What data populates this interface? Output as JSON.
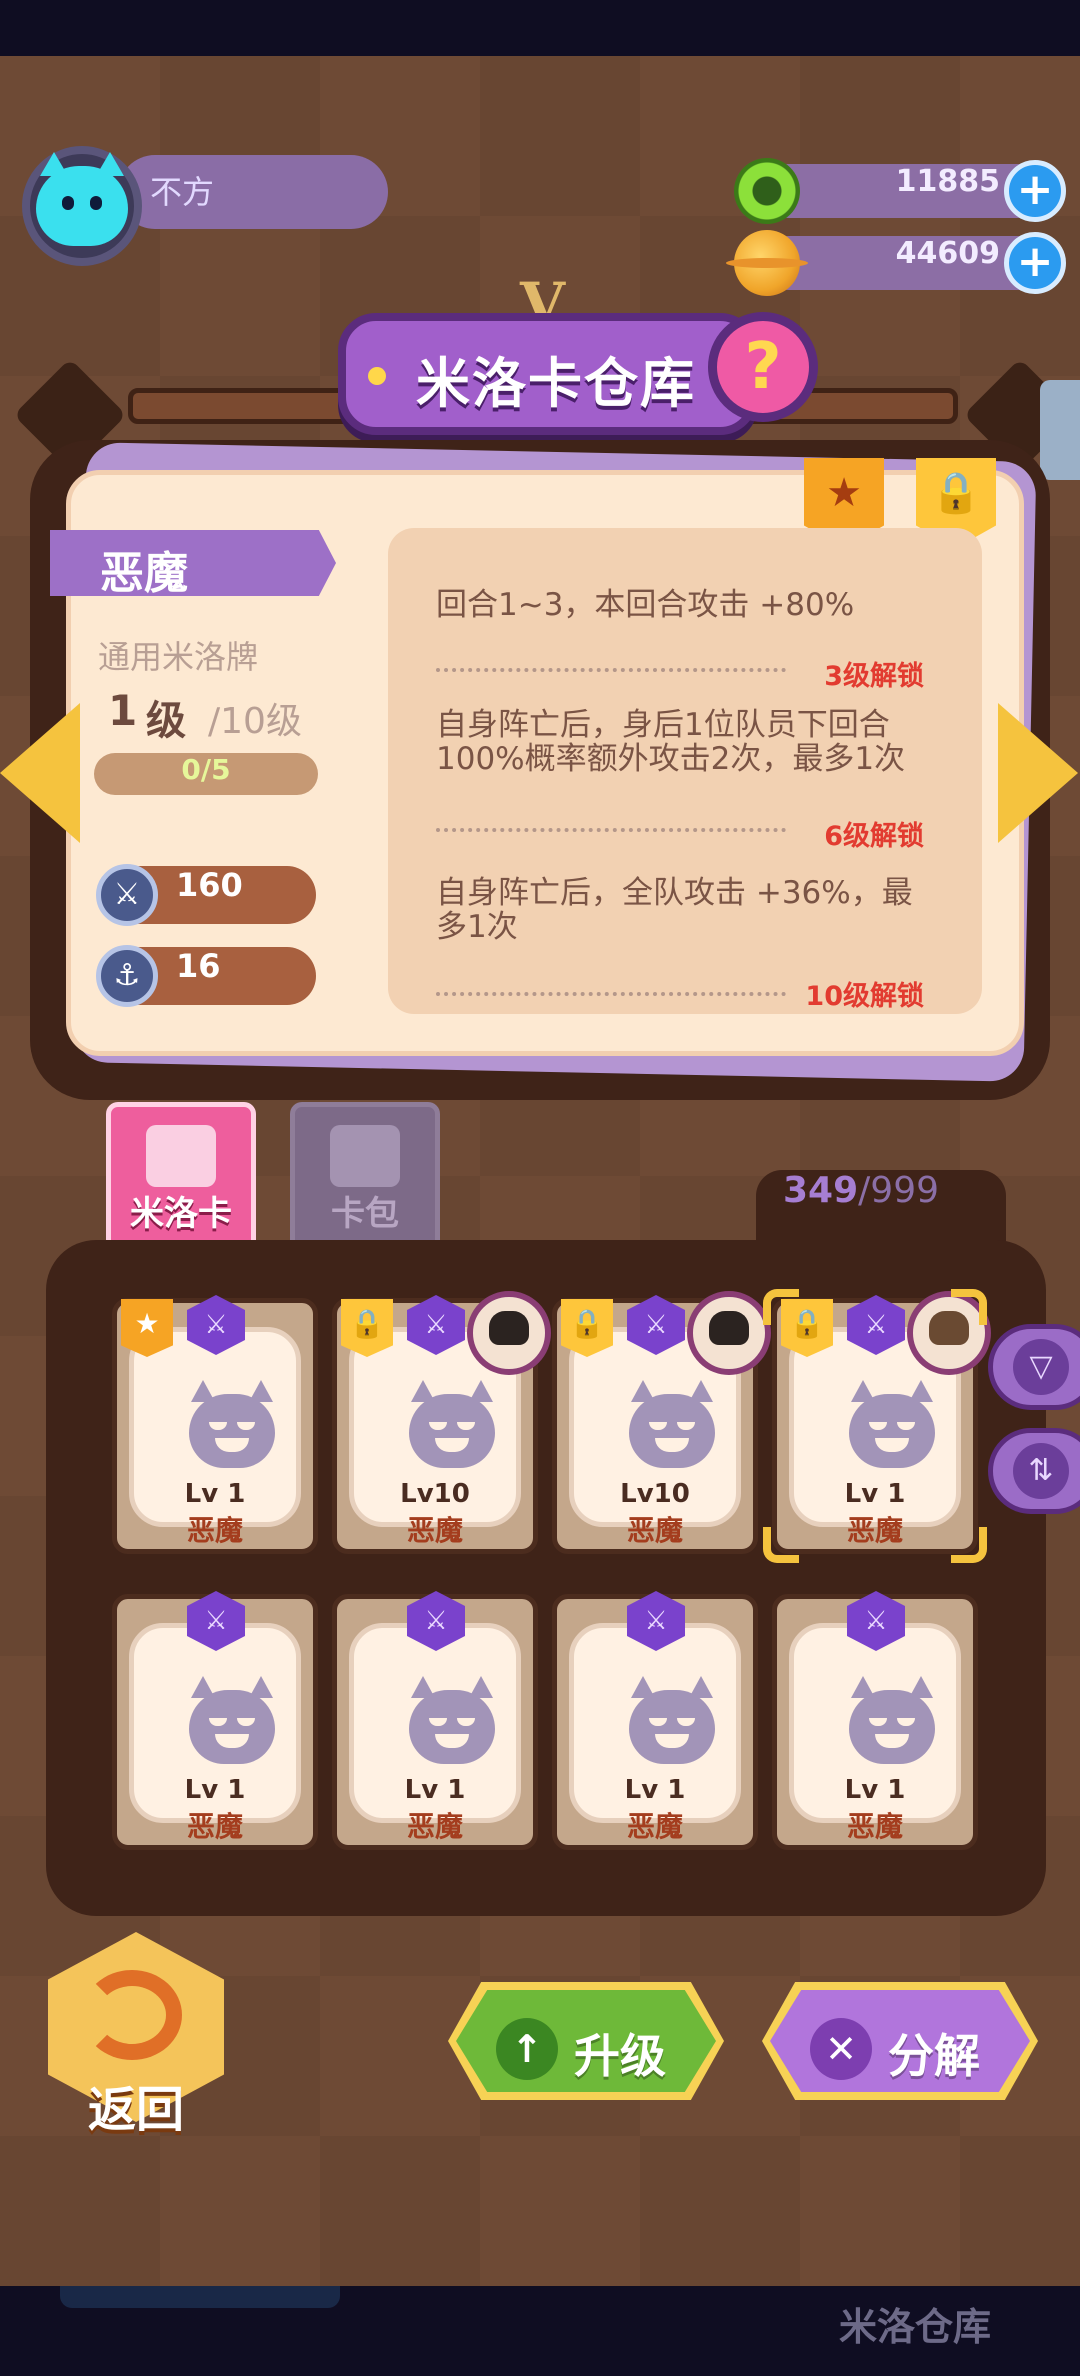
{
  "player": {
    "name": "不方"
  },
  "currencies": [
    {
      "value": "11885",
      "icon": "green-donut-coin-icon"
    },
    {
      "value": "44609",
      "icon": "gold-planet-coin-icon"
    }
  ],
  "title": {
    "text": "米洛卡仓库",
    "help": "?"
  },
  "card_detail": {
    "name": "恶魔",
    "type": "通用米洛牌",
    "level": "1",
    "level_unit": "级",
    "level_max": "/10级",
    "progress_text": "0/5",
    "progress": 0,
    "stats": [
      {
        "icon": "attack-icon",
        "value": "160"
      },
      {
        "icon": "defense-icon",
        "value": "16"
      }
    ],
    "skills": [
      {
        "desc": "回合1~3，本回合攻击 +80%",
        "unlock": "3级解锁"
      },
      {
        "desc": "自身阵亡后，身后1位队员下回合100%概率额外攻击2次，最多1次",
        "unlock": "6级解锁"
      },
      {
        "desc": "自身阵亡后，全队攻击 +36%，最多1次",
        "unlock": "10级解锁"
      }
    ]
  },
  "tabs": [
    {
      "label": "米洛卡",
      "active": true
    },
    {
      "label": "卡包",
      "active": false
    }
  ],
  "inventory": {
    "count": "349",
    "max": "/999",
    "cards": [
      {
        "lv": "Lv 1",
        "name": "恶魔",
        "badge": "star",
        "avatar": false
      },
      {
        "lv": "Lv10",
        "name": "恶魔",
        "badge": "lock",
        "avatar": "dark"
      },
      {
        "lv": "Lv10",
        "name": "恶魔",
        "badge": "lock",
        "avatar": "dark"
      },
      {
        "lv": "Lv 1",
        "name": "恶魔",
        "badge": "lock",
        "avatar": "brown",
        "selected": true
      },
      {
        "lv": "Lv 1",
        "name": "恶魔",
        "badge": null,
        "avatar": false
      },
      {
        "lv": "Lv 1",
        "name": "恶魔",
        "badge": null,
        "avatar": false
      },
      {
        "lv": "Lv 1",
        "name": "恶魔",
        "badge": null,
        "avatar": false
      },
      {
        "lv": "Lv 1",
        "name": "恶魔",
        "badge": null,
        "avatar": false
      }
    ]
  },
  "buttons": {
    "back": "返回",
    "upgrade": "升级",
    "decompose": "分解"
  },
  "bottom_tab": "米洛仓库"
}
